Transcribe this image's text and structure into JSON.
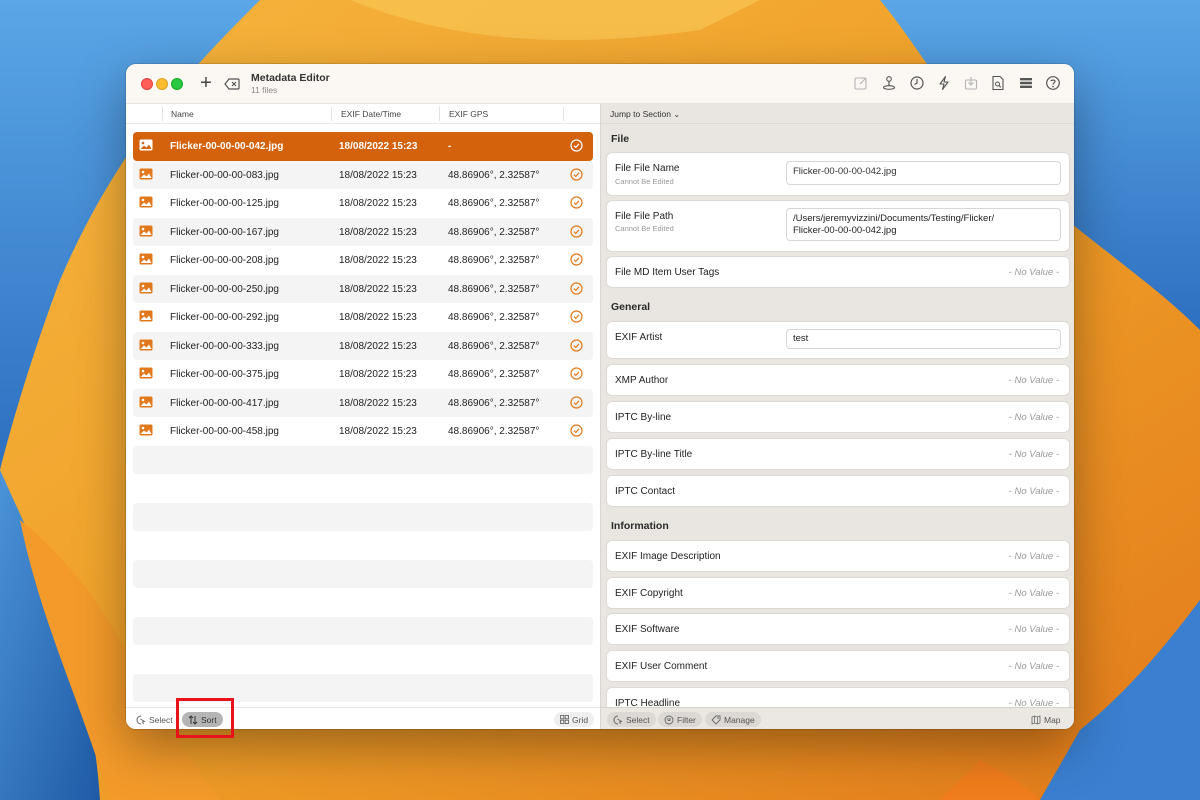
{
  "window": {
    "title": "Metadata Editor",
    "subtitle": "11 files"
  },
  "toolbar": {
    "add_icon": "plus-icon",
    "delete_icon": "delete-left-icon",
    "tools": [
      "edit-icon",
      "joystick-icon",
      "clock-icon",
      "bolt-icon",
      "import-icon",
      "document-search-icon",
      "list-icon",
      "help-icon"
    ]
  },
  "columns": {
    "name": "Name",
    "date": "EXIF Date/Time",
    "gps": "EXIF GPS"
  },
  "files": [
    {
      "name": "Flicker-00-00-00-042.jpg",
      "date": "18/08/2022 15:23",
      "gps": "-",
      "selected": true
    },
    {
      "name": "Flicker-00-00-00-083.jpg",
      "date": "18/08/2022 15:23",
      "gps": "48.86906°, 2.32587°"
    },
    {
      "name": "Flicker-00-00-00-125.jpg",
      "date": "18/08/2022 15:23",
      "gps": "48.86906°, 2.32587°"
    },
    {
      "name": "Flicker-00-00-00-167.jpg",
      "date": "18/08/2022 15:23",
      "gps": "48.86906°, 2.32587°"
    },
    {
      "name": "Flicker-00-00-00-208.jpg",
      "date": "18/08/2022 15:23",
      "gps": "48.86906°, 2.32587°"
    },
    {
      "name": "Flicker-00-00-00-250.jpg",
      "date": "18/08/2022 15:23",
      "gps": "48.86906°, 2.32587°"
    },
    {
      "name": "Flicker-00-00-00-292.jpg",
      "date": "18/08/2022 15:23",
      "gps": "48.86906°, 2.32587°"
    },
    {
      "name": "Flicker-00-00-00-333.jpg",
      "date": "18/08/2022 15:23",
      "gps": "48.86906°, 2.32587°"
    },
    {
      "name": "Flicker-00-00-00-375.jpg",
      "date": "18/08/2022 15:23",
      "gps": "48.86906°, 2.32587°"
    },
    {
      "name": "Flicker-00-00-00-417.jpg",
      "date": "18/08/2022 15:23",
      "gps": "48.86906°, 2.32587°"
    },
    {
      "name": "Flicker-00-00-00-458.jpg",
      "date": "18/08/2022 15:23",
      "gps": "48.86906°, 2.32587°"
    }
  ],
  "left_footer": {
    "select": "Select",
    "sort": "Sort",
    "grid": "Grid"
  },
  "inspector": {
    "jump": "Jump to Section",
    "sections": {
      "file": "File",
      "general": "General",
      "information": "Information"
    },
    "file_name": {
      "label": "File File Name",
      "note": "Cannot Be Edited",
      "value": "Flicker-00-00-00-042.jpg"
    },
    "file_path": {
      "label": "File File Path",
      "note": "Cannot Be Edited",
      "value_line1": "/Users/jeremyvizzini/Documents/Testing/Flicker/",
      "value_line2": "Flicker-00-00-00-042.jpg"
    },
    "md_tags": {
      "label": "File MD Item User Tags",
      "value": "- No Value -"
    },
    "exif_artist": {
      "label": "EXIF Artist",
      "value": "test"
    },
    "xmp_author": {
      "label": "XMP Author",
      "value": "- No Value -"
    },
    "iptc_byline": {
      "label": "IPTC By-line",
      "value": "- No Value -"
    },
    "iptc_byline_title": {
      "label": "IPTC By-line Title",
      "value": "- No Value -"
    },
    "iptc_contact": {
      "label": "IPTC Contact",
      "value": "- No Value -"
    },
    "exif_image_desc": {
      "label": "EXIF Image Description",
      "value": "- No Value -"
    },
    "exif_copyright": {
      "label": "EXIF Copyright",
      "value": "- No Value -"
    },
    "exif_software": {
      "label": "EXIF Software",
      "value": "- No Value -"
    },
    "exif_user_comment": {
      "label": "EXIF User Comment",
      "value": "- No Value -"
    },
    "iptc_headline": {
      "label": "IPTC Headline",
      "value": "- No Value -"
    }
  },
  "right_footer": {
    "select": "Select",
    "filter": "Filter",
    "manage": "Manage",
    "map": "Map"
  },
  "colors": {
    "accent": "#d4620c",
    "highlight": "#e8121a"
  }
}
